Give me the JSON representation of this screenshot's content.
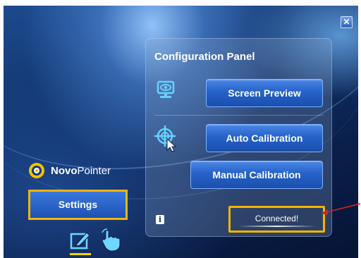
{
  "panel": {
    "title": "Configuration Panel",
    "screen_preview_label": "Screen Preview",
    "auto_calibration_label": "Auto Calibration",
    "manual_calibration_label": "Manual Calibration",
    "info_label": "i",
    "status_text": "Connected!"
  },
  "logo": {
    "bold_part": "Novo",
    "light_part": "Pointer"
  },
  "sidebar": {
    "settings_label": "Settings"
  },
  "window": {
    "close_label": "✕"
  },
  "icons": [
    "monitor-eye-icon",
    "crosshair-target-icon",
    "novo-logo-icon",
    "pen-mode-icon",
    "hand-touch-icon",
    "info-icon",
    "close-icon"
  ],
  "colors": {
    "highlight": "#f5b400",
    "button_blue": "#2662c8",
    "arrow": "#d62020"
  }
}
